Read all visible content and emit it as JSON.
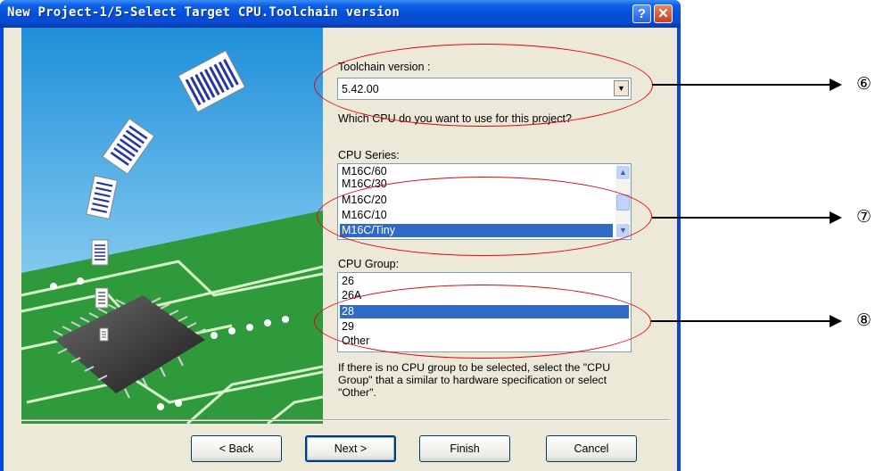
{
  "window": {
    "title": "New Project-1/5-Select Target CPU.Toolchain version",
    "help_glyph": "?",
    "close_glyph": "✕"
  },
  "toolchain": {
    "label": "Toolchain version :",
    "value": "5.42.00",
    "arrow_glyph": "▼"
  },
  "question": "Which CPU do you want to use for this project?",
  "cpu_series": {
    "label": "CPU Series:",
    "items": [
      "M16C/60",
      "M16C/30",
      "M16C/20",
      "M16C/10",
      "M16C/Tiny"
    ],
    "selected_index": 4
  },
  "cpu_group": {
    "label": "CPU Group:",
    "items": [
      "26",
      "26A",
      "28",
      "29",
      "Other"
    ],
    "selected_index": 2
  },
  "hint": "If there is no CPU group to be selected, select the \"CPU Group\" that a similar to hardware specification or select \"Other\".",
  "buttons": {
    "back": "< Back",
    "next": "Next >",
    "finish": "Finish",
    "cancel": "Cancel"
  },
  "annotations": [
    "⑥",
    "⑦",
    "⑧"
  ],
  "colors": {
    "titlebar": "#0a46d8",
    "selection": "#316ac5",
    "annotation_ellipse": "#e8000d",
    "dialog_bg": "#ece9d8"
  }
}
